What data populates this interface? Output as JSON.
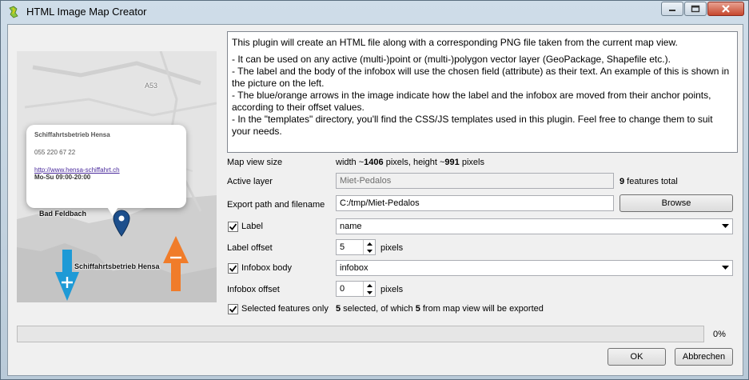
{
  "window": {
    "title": "HTML Image Map Creator"
  },
  "description": {
    "intro": "This plugin will create an HTML file along with a corresponding PNG file taken from the current map view.",
    "bullets": [
      "- It can be used on any active (multi-)point or (multi-)polygon vector layer (GeoPackage, Shapefile etc.).",
      "- The label and the body of the infobox will use the chosen field (attribute) as their text. An example of this is shown in the picture on the left.",
      "- The blue/orange arrows in the image indicate how the label and the infobox are moved from their anchor points, according to their offset values.",
      "- In the \"templates\" directory, you'll find the CSS/JS templates used in this plugin. Feel free to change them to suit your needs."
    ]
  },
  "preview": {
    "popup_title": "Schiffahrtsbetrieb Hensa",
    "popup_phone": "055 220 67 22",
    "popup_link": "http://www.hensa-schiffahrt.ch",
    "popup_hours": "Mo-Su 09:00-20:00",
    "marker_label": "Schiffahrtsbetrieb Hensa",
    "place_label": "Bad Feldbach",
    "road_label": "A53"
  },
  "map_view": {
    "label": "Map view size",
    "width_prefix": "width ~",
    "width": "1406",
    "height_prefix": " pixels, height ~",
    "height": "991",
    "suffix": " pixels"
  },
  "active_layer": {
    "label": "Active layer",
    "value": "Miet-Pedalos",
    "count": "9",
    "count_suffix": " features total"
  },
  "export": {
    "label": "Export path and filename",
    "value": "C:/tmp/Miet-Pedalos",
    "browse": "Browse"
  },
  "label_row": {
    "label": "Label",
    "checked": true,
    "field": "name"
  },
  "label_offset": {
    "label": "Label offset",
    "value": "5",
    "unit": "pixels"
  },
  "infobox_row": {
    "label": "Infobox body",
    "checked": true,
    "field": "infobox"
  },
  "infobox_offset": {
    "label": "Infobox offset",
    "value": "0",
    "unit": "pixels"
  },
  "selected_row": {
    "label": "Selected features only",
    "checked": true,
    "selected": "5",
    "middle": " selected, of which ",
    "exported": "5",
    "suffix": " from map view will be exported"
  },
  "progress": {
    "percent": 0,
    "text": "0%"
  },
  "buttons": {
    "ok": "OK",
    "cancel": "Abbrechen"
  },
  "colors": {
    "arrow_blue": "#1e9ad6",
    "arrow_orange": "#f07c2a",
    "marker": "#1d4f8c",
    "progress_fill": "#06b025"
  }
}
